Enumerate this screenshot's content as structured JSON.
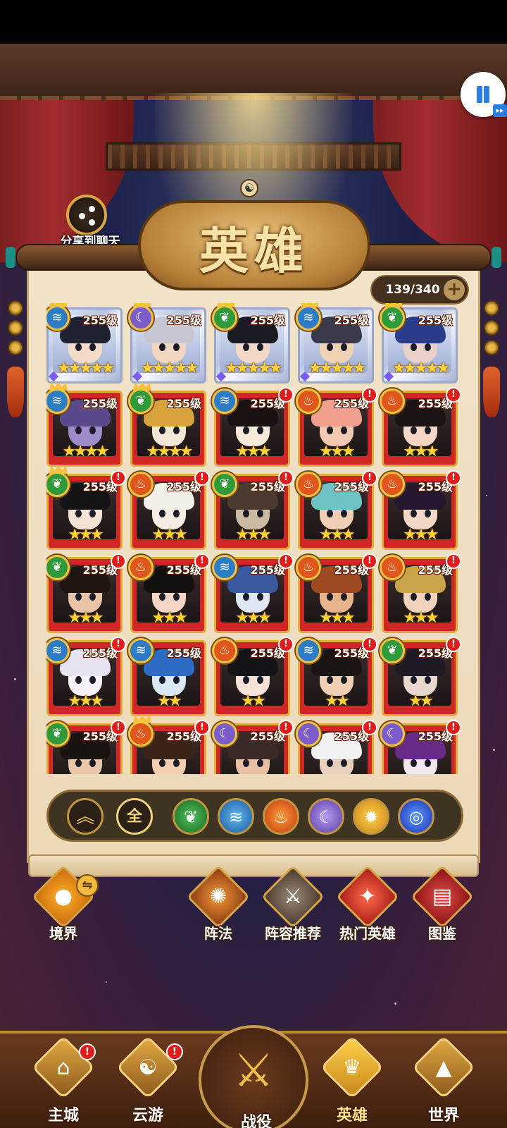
{
  "share": {
    "label": "分享到聊天",
    "icon": "share-icon"
  },
  "controls": {
    "pause_icon": "pause-icon",
    "fast_forward_badge": "▸▸"
  },
  "header": {
    "title": "英雄"
  },
  "hero_count": {
    "text": "139/340",
    "plus": "+"
  },
  "filters": {
    "collapse": "︽",
    "all": "全",
    "elements": [
      "wood",
      "water",
      "fire",
      "moon",
      "sun",
      "swirl"
    ]
  },
  "heroes": [
    {
      "element": "water",
      "level": "255级",
      "stars": "★★★★★",
      "rarity": "silver",
      "alert": false,
      "crown": true,
      "skin": "#f4dcc8",
      "hair": "#1f2230"
    },
    {
      "element": "moon",
      "level": "255级",
      "stars": "★★★★★",
      "rarity": "silver",
      "alert": false,
      "crown": true,
      "skin": "#f3d6c0",
      "hair": "#c7c7d2"
    },
    {
      "element": "wood",
      "level": "255级",
      "stars": "★★★★★",
      "rarity": "silver",
      "alert": false,
      "crown": true,
      "skin": "#f2d8c6",
      "hair": "#1a1a22"
    },
    {
      "element": "water",
      "level": "255级",
      "stars": "★★★★★",
      "rarity": "silver",
      "alert": false,
      "crown": true,
      "skin": "#f0d2b4",
      "hair": "#3a3a4a"
    },
    {
      "element": "wood",
      "level": "255级",
      "stars": "★★★★★",
      "rarity": "silver",
      "alert": false,
      "crown": true,
      "skin": "#e9d0c8",
      "hair": "#2a3c8a"
    },
    {
      "element": "water",
      "level": "255级",
      "stars": "★★★★",
      "rarity": "red",
      "alert": false,
      "crown": true,
      "skin": "#9d8cc9",
      "hair": "#5a4a8c"
    },
    {
      "element": "wood",
      "level": "255级",
      "stars": "★★★★",
      "rarity": "red",
      "alert": false,
      "crown": true,
      "skin": "#f2e6d6",
      "hair": "#d9a23a"
    },
    {
      "element": "water",
      "level": "255级",
      "stars": "★★★",
      "rarity": "red",
      "alert": true,
      "crown": false,
      "skin": "#f6ead8",
      "hair": "#1a1212"
    },
    {
      "element": "fire",
      "level": "255级",
      "stars": "★★★",
      "rarity": "red",
      "alert": true,
      "crown": false,
      "skin": "#f3c7b2",
      "hair": "#f0a08c"
    },
    {
      "element": "fire",
      "level": "255级",
      "stars": "★★★",
      "rarity": "red",
      "alert": true,
      "crown": false,
      "skin": "#f3d6c4",
      "hair": "#1c1414"
    },
    {
      "element": "wood",
      "level": "255级",
      "stars": "★★★",
      "rarity": "red",
      "alert": true,
      "crown": true,
      "skin": "#f4e2d4",
      "hair": "#141418"
    },
    {
      "element": "fire",
      "level": "255级",
      "stars": "★★★",
      "rarity": "red",
      "alert": true,
      "crown": false,
      "skin": "#f6ece4",
      "hair": "#f2efe8"
    },
    {
      "element": "wood",
      "level": "255级",
      "stars": "★★★",
      "rarity": "red",
      "alert": true,
      "crown": false,
      "skin": "#cbb9a4",
      "hair": "#4a3a30"
    },
    {
      "element": "fire",
      "level": "255级",
      "stars": "★★★",
      "rarity": "red",
      "alert": true,
      "crown": false,
      "skin": "#f0cfb6",
      "hair": "#6fc2c4"
    },
    {
      "element": "fire",
      "level": "255级",
      "stars": "★★★",
      "rarity": "red",
      "alert": true,
      "crown": false,
      "skin": "#f3d8c8",
      "hair": "#26162e"
    },
    {
      "element": "wood",
      "level": "255级",
      "stars": "★★★",
      "rarity": "red",
      "alert": true,
      "crown": false,
      "skin": "#e9c4a6",
      "hair": "#201510"
    },
    {
      "element": "fire",
      "level": "255级",
      "stars": "★★★",
      "rarity": "red",
      "alert": true,
      "crown": false,
      "skin": "#f4d6c4",
      "hair": "#151010"
    },
    {
      "element": "water",
      "level": "255级",
      "stars": "★★★",
      "rarity": "red",
      "alert": true,
      "crown": false,
      "skin": "#dfe6f4",
      "hair": "#3a5aa0"
    },
    {
      "element": "fire",
      "level": "255级",
      "stars": "★★★",
      "rarity": "red",
      "alert": true,
      "crown": false,
      "skin": "#e8b48c",
      "hair": "#a04a24"
    },
    {
      "element": "fire",
      "level": "255级",
      "stars": "★★★",
      "rarity": "red",
      "alert": true,
      "crown": false,
      "skin": "#f2d4bc",
      "hair": "#c9a44a"
    },
    {
      "element": "water",
      "level": "255级",
      "stars": "★★★",
      "rarity": "red",
      "alert": true,
      "crown": false,
      "skin": "#f6f2f8",
      "hair": "#e6e4f0"
    },
    {
      "element": "water",
      "level": "255级",
      "stars": "★★",
      "rarity": "red",
      "alert": false,
      "crown": false,
      "skin": "#dbe8f6",
      "hair": "#2d6cc4"
    },
    {
      "element": "fire",
      "level": "255级",
      "stars": "★★",
      "rarity": "red",
      "alert": true,
      "crown": false,
      "skin": "#f6e2d8",
      "hair": "#141418"
    },
    {
      "element": "water",
      "level": "255级",
      "stars": "★★",
      "rarity": "red",
      "alert": true,
      "crown": false,
      "skin": "#f0cfb4",
      "hair": "#1a1414"
    },
    {
      "element": "wood",
      "level": "255级",
      "stars": "★★",
      "rarity": "red",
      "alert": true,
      "crown": false,
      "skin": "#e9d6cc",
      "hair": "#201a24"
    },
    {
      "element": "wood",
      "level": "255级",
      "stars": "",
      "rarity": "red",
      "alert": true,
      "crown": false,
      "skin": "#e9c6a8",
      "hair": "#1a1410"
    },
    {
      "element": "fire",
      "level": "255级",
      "stars": "",
      "rarity": "red",
      "alert": true,
      "crown": true,
      "skin": "#f2cdb0",
      "hair": "#3a2418"
    },
    {
      "element": "moon",
      "level": "255级",
      "stars": "",
      "rarity": "red",
      "alert": true,
      "crown": false,
      "skin": "#eac0a4",
      "hair": "#3a2a28"
    },
    {
      "element": "moon",
      "level": "255级",
      "stars": "",
      "rarity": "red",
      "alert": true,
      "crown": false,
      "skin": "#e8d0bc",
      "hair": "#f2f2f2"
    },
    {
      "element": "moon",
      "level": "255级",
      "stars": "",
      "rarity": "red",
      "alert": true,
      "crown": false,
      "skin": "#f2e8f0",
      "hair": "#6a2a8a"
    }
  ],
  "actions": [
    {
      "label": "境界",
      "icon": "realm-icon",
      "glyph": "●"
    },
    {
      "label": "阵法",
      "icon": "formation-icon",
      "glyph": "✺"
    },
    {
      "label": "阵容推荐",
      "icon": "lineup-recommend-icon",
      "glyph": "⚔"
    },
    {
      "label": "热门英雄",
      "icon": "hot-heroes-icon",
      "glyph": "✦"
    },
    {
      "label": "图鉴",
      "icon": "codex-icon",
      "glyph": "▤"
    }
  ],
  "actions_swap": "⇋",
  "nav": [
    {
      "label": "主城",
      "icon": "main-city-icon",
      "glyph": "⌂",
      "alert": "!"
    },
    {
      "label": "云游",
      "icon": "travel-icon",
      "glyph": "☯",
      "alert": "!"
    },
    {
      "label": "战役",
      "icon": "battle-icon",
      "glyph": "⚔",
      "alert": ""
    },
    {
      "label": "英雄",
      "icon": "hero-icon",
      "glyph": "♛",
      "alert": "",
      "active": true
    },
    {
      "label": "世界",
      "icon": "world-icon",
      "glyph": "▲",
      "alert": ""
    }
  ],
  "element_colors": {
    "wood": "#2f9a3a",
    "water": "#2c7cc6",
    "fire": "#e0571c",
    "moon": "#7b5cc8",
    "sun": "#e5a42a",
    "swirl": "#2b4fd8"
  },
  "element_glyphs": {
    "wood": "❦",
    "water": "≋",
    "fire": "♨",
    "moon": "☾",
    "sun": "✹",
    "swirl": "◎"
  }
}
